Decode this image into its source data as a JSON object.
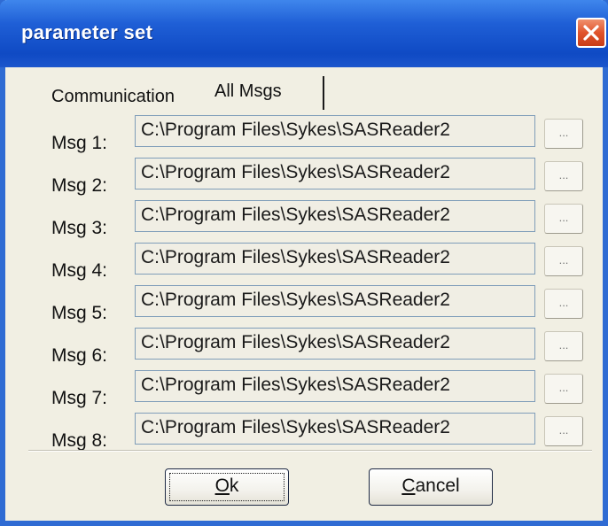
{
  "window": {
    "title": "parameter set",
    "close_icon": "close-x-icon",
    "colors": {
      "titlebar": "#1f5fd6",
      "client": "#f1efe3",
      "close": "#e0532b"
    }
  },
  "tabs": [
    {
      "label": "Communication",
      "selected": false
    },
    {
      "label": "All Msgs",
      "selected": true
    }
  ],
  "messages": [
    {
      "label": "Msg 1:",
      "value": "C:\\Program Files\\Sykes\\SASReader2",
      "browse_label": "..."
    },
    {
      "label": "Msg 2:",
      "value": "C:\\Program Files\\Sykes\\SASReader2",
      "browse_label": "..."
    },
    {
      "label": "Msg 3:",
      "value": "C:\\Program Files\\Sykes\\SASReader2",
      "browse_label": "..."
    },
    {
      "label": "Msg 4:",
      "value": "C:\\Program Files\\Sykes\\SASReader2",
      "browse_label": "..."
    },
    {
      "label": "Msg 5:",
      "value": "C:\\Program Files\\Sykes\\SASReader2",
      "browse_label": "..."
    },
    {
      "label": "Msg 6:",
      "value": "C:\\Program Files\\Sykes\\SASReader2",
      "browse_label": "..."
    },
    {
      "label": "Msg 7:",
      "value": "C:\\Program Files\\Sykes\\SASReader2",
      "browse_label": "..."
    },
    {
      "label": "Msg 8:",
      "value": "C:\\Program Files\\Sykes\\SASReader2",
      "browse_label": "..."
    }
  ],
  "buttons": {
    "ok": {
      "mnemonic": "O",
      "rest": "k"
    },
    "cancel": {
      "mnemonic": "C",
      "rest": "ancel"
    }
  }
}
